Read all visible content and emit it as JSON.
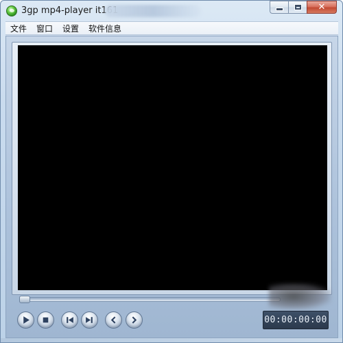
{
  "window": {
    "title": "3gp mp4-player it161",
    "controls": {
      "minimize": "minimize",
      "maximize": "maximize",
      "close": "✕"
    }
  },
  "menu": {
    "items": [
      "文件",
      "窗口",
      "设置",
      "软件信息"
    ]
  },
  "player": {
    "time": "00:00:00:00",
    "seek_progress": 0.0,
    "buttons": [
      {
        "name": "play-button",
        "icon": "play-icon"
      },
      {
        "name": "stop-button",
        "icon": "stop-icon"
      },
      {
        "name": "previous-button",
        "icon": "skip-back-icon"
      },
      {
        "name": "next-button",
        "icon": "skip-forward-icon"
      },
      {
        "name": "rewind-button",
        "icon": "chevron-left-icon"
      },
      {
        "name": "forward-button",
        "icon": "chevron-right-icon"
      }
    ]
  },
  "colors": {
    "video_bg": "#000000",
    "chrome": "#aec3dc",
    "time_bg": "#2b394c"
  }
}
